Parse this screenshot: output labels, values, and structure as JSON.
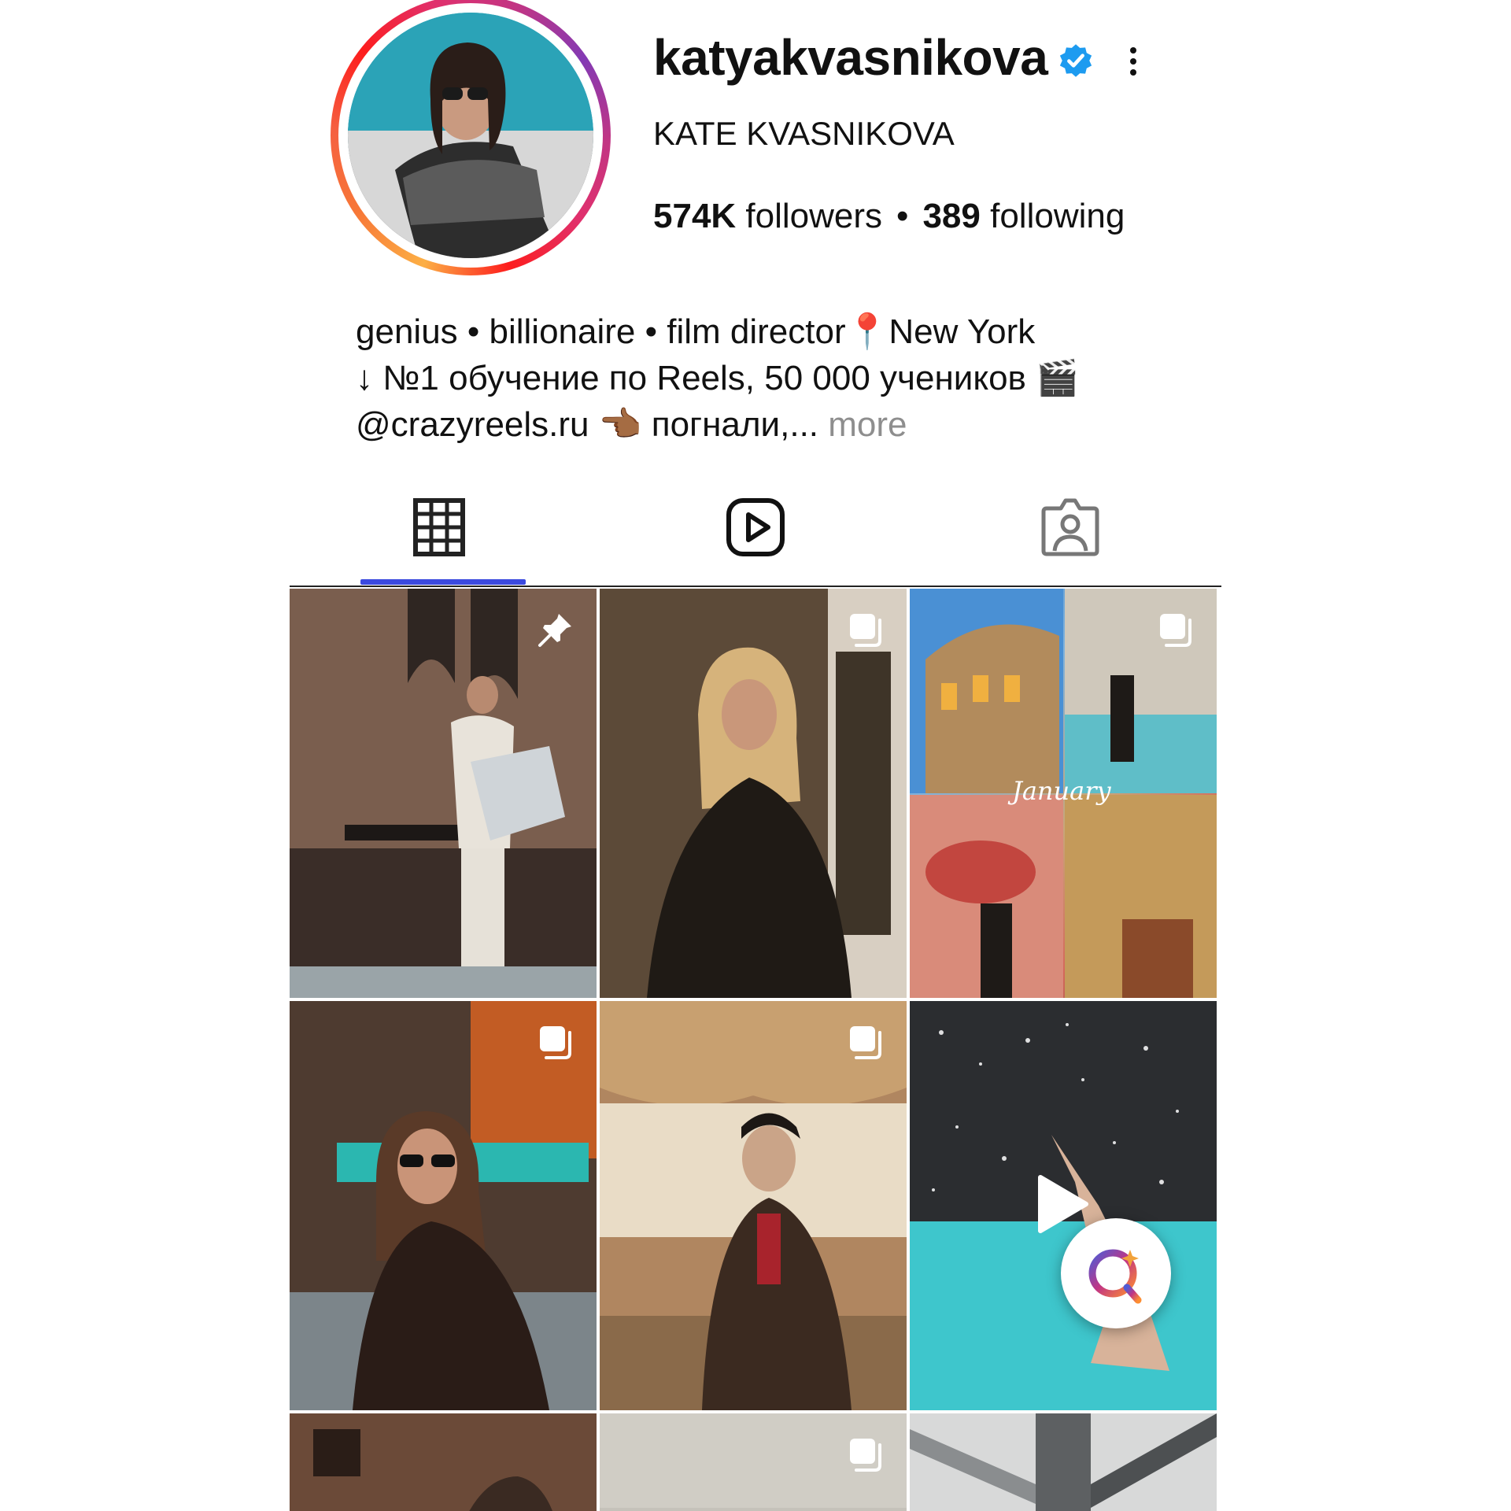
{
  "profile": {
    "username": "katyakvasnikova",
    "full_name": "KATE KVASNIKOVA",
    "followers_count": "574K",
    "followers_label": "followers",
    "separator": "•",
    "following_count": "389",
    "following_label": "following",
    "verified": true,
    "avatar_icon": "profile-photo"
  },
  "bio": {
    "line1": "genius • billionaire • film director📍New York",
    "line2": "↓ №1 обучение по Reels, 50 000 учеников 🎬",
    "line3_handle": "@crazyreels.ru",
    "line3_rest": " 👈🏾 погнали,...",
    "more_label": " more"
  },
  "tabs": [
    {
      "name": "posts",
      "icon": "grid-icon",
      "active": true
    },
    {
      "name": "reels",
      "icon": "reels-icon",
      "active": false
    },
    {
      "name": "tagged",
      "icon": "tagged-icon",
      "active": false
    }
  ],
  "grid": {
    "tiles": [
      {
        "type": "pinned",
        "icon": "pin-icon"
      },
      {
        "type": "carousel",
        "icon": "carousel-icon"
      },
      {
        "type": "carousel",
        "icon": "carousel-icon",
        "overlay_text": "January"
      },
      {
        "type": "carousel",
        "icon": "carousel-icon"
      },
      {
        "type": "carousel",
        "icon": "carousel-icon"
      },
      {
        "type": "video",
        "icon": "play-icon"
      },
      {
        "type": "photo"
      },
      {
        "type": "carousel",
        "icon": "carousel-icon"
      },
      {
        "type": "photo"
      }
    ]
  },
  "floating": {
    "icon": "lens-search-icon"
  },
  "colors": {
    "verified_blue": "#1d9bf0",
    "tab_accent": "#3b49df",
    "muted_text": "#8e8e8e"
  }
}
